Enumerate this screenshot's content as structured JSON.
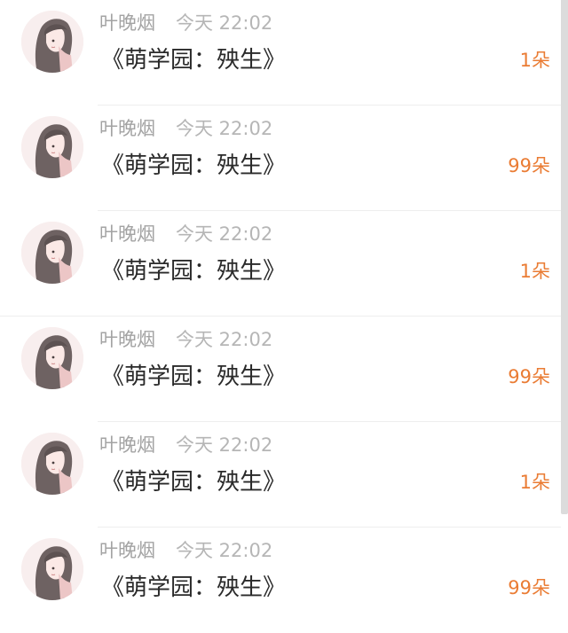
{
  "feed": {
    "items": [
      {
        "name": "叶晚烟",
        "time": "今天 22:02",
        "message": "《萌学园：殃生》",
        "gift": "1朵"
      },
      {
        "name": "叶晚烟",
        "time": "今天 22:02",
        "message": "《萌学园：殃生》",
        "gift": "99朵"
      },
      {
        "name": "叶晚烟",
        "time": "今天 22:02",
        "message": "《萌学园：殃生》",
        "gift": "1朵"
      },
      {
        "name": "叶晚烟",
        "time": "今天 22:02",
        "message": "《萌学园：殃生》",
        "gift": "99朵"
      },
      {
        "name": "叶晚烟",
        "time": "今天 22:02",
        "message": "《萌学园：殃生》",
        "gift": "1朵"
      },
      {
        "name": "叶晚烟",
        "time": "今天 22:02",
        "message": "《萌学园：殃生》",
        "gift": "99朵"
      }
    ]
  },
  "colors": {
    "gift": "#ea7c34",
    "name": "#a3a3a3",
    "time": "#b6b6b6",
    "message": "#2a2a2a",
    "separator": "#eeeeee"
  },
  "icons": {
    "avatar": "illustrated-girl-avatar"
  }
}
